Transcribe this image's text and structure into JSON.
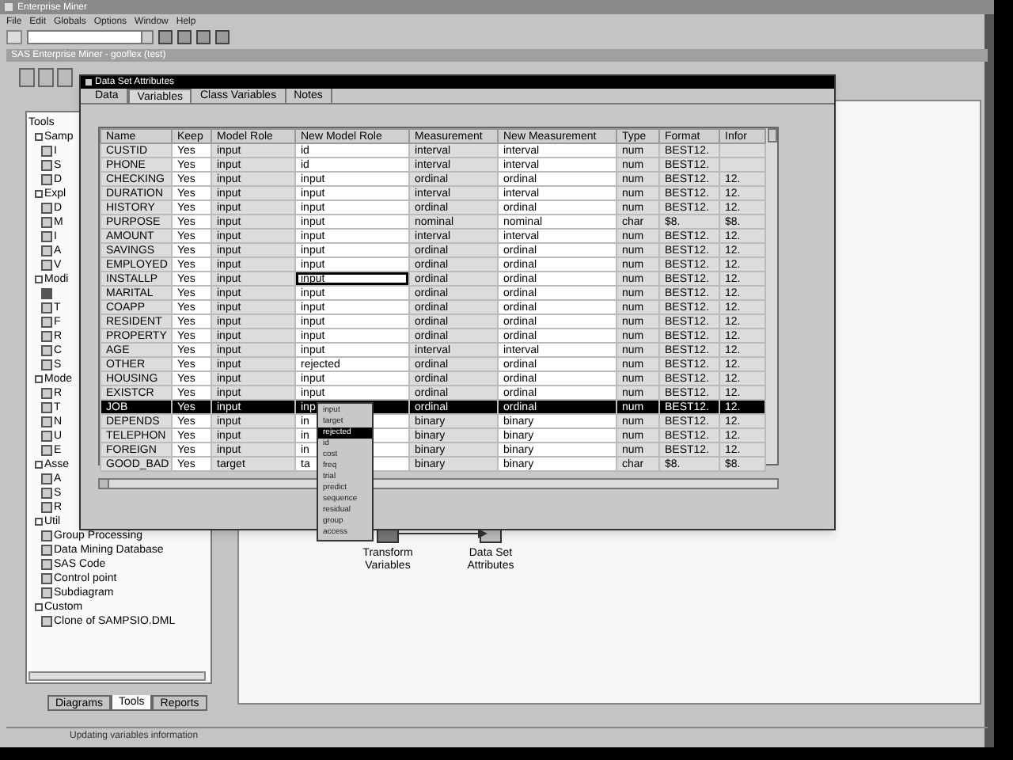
{
  "app": {
    "title": "Enterprise Miner",
    "menu": [
      "File",
      "Edit",
      "Globals",
      "Options",
      "Window",
      "Help"
    ]
  },
  "main_window": {
    "title": "SAS Enterprise Miner - gooflex (test)"
  },
  "tools_panel": {
    "tree": [
      {
        "label": "Tools",
        "expanded": true,
        "children": [
          {
            "label": "Samp",
            "expanded": true,
            "children": [
              {
                "label": "I",
                "selected": false
              },
              {
                "label": "S",
                "selected": false
              },
              {
                "label": "D",
                "selected": false
              }
            ]
          },
          {
            "label": "Expl",
            "expanded": true,
            "children": [
              {
                "label": "D",
                "selected": false
              },
              {
                "label": "M",
                "selected": false
              },
              {
                "label": "I",
                "selected": false
              },
              {
                "label": "A",
                "selected": false
              },
              {
                "label": "V",
                "selected": false
              }
            ]
          },
          {
            "label": "Modi",
            "expanded": true,
            "children": [
              {
                "selected": true
              },
              {
                "label": "T",
                "selected": false
              },
              {
                "label": "F",
                "selected": false
              },
              {
                "label": "R",
                "selected": false
              },
              {
                "label": "C",
                "selected": false
              },
              {
                "label": "S",
                "selected": false
              }
            ]
          },
          {
            "label": "Mode",
            "expanded": true,
            "children": [
              {
                "label": "R",
                "selected": false
              },
              {
                "label": "T",
                "selected": false
              },
              {
                "label": "N",
                "selected": false
              },
              {
                "label": "U",
                "selected": false
              },
              {
                "label": "E",
                "selected": false
              }
            ]
          },
          {
            "label": "Asse",
            "expanded": true,
            "children": [
              {
                "label": "A",
                "selected": false
              },
              {
                "label": "S",
                "selected": false
              },
              {
                "label": "R",
                "selected": false
              }
            ]
          },
          {
            "label": "Util",
            "expanded": true,
            "children": [
              {
                "label": "Group Processing",
                "selected": false
              },
              {
                "label": "Data Mining Database",
                "selected": false
              },
              {
                "label": "SAS Code",
                "selected": false
              },
              {
                "label": "Control point",
                "selected": false
              },
              {
                "label": "Subdiagram",
                "selected": false
              }
            ]
          },
          {
            "label": "Custom",
            "expanded": true,
            "children": [
              {
                "label": "Clone of SAMPSIO.DML",
                "selected": false
              }
            ]
          }
        ]
      }
    ],
    "tabs": [
      {
        "label": "Diagrams",
        "selected": false
      },
      {
        "label": "Tools",
        "selected": true
      },
      {
        "label": "Reports",
        "selected": false
      }
    ]
  },
  "diagram": {
    "nodes": [
      {
        "label": "Transform Variables"
      },
      {
        "label": "Data Set Attributes"
      }
    ]
  },
  "dialog": {
    "title": "Data Set Attributes",
    "tabs": [
      {
        "label": "Data",
        "selected": false
      },
      {
        "label": "Variables",
        "selected": true
      },
      {
        "label": "Class Variables",
        "selected": false
      },
      {
        "label": "Notes",
        "selected": false
      }
    ],
    "table": {
      "columns": [
        "Name",
        "Keep",
        "Model Role",
        "New Model Role",
        "Measurement",
        "New Measurement",
        "Type",
        "Format",
        "Infor"
      ],
      "rows": [
        {
          "cells": [
            "CUSTID",
            "Yes",
            "input",
            "id",
            "interval",
            "interval",
            "num",
            "BEST12."
          ],
          "selected": false,
          "editing": false
        },
        {
          "cells": [
            "PHONE",
            "Yes",
            "input",
            "id",
            "interval",
            "interval",
            "num",
            "BEST12."
          ],
          "selected": false,
          "editing": false
        },
        {
          "cells": [
            "CHECKING",
            "Yes",
            "input",
            "input",
            "ordinal",
            "ordinal",
            "num",
            "BEST12.",
            "12."
          ],
          "selected": false,
          "editing": false
        },
        {
          "cells": [
            "DURATION",
            "Yes",
            "input",
            "input",
            "interval",
            "interval",
            "num",
            "BEST12.",
            "12."
          ],
          "selected": false,
          "editing": false
        },
        {
          "cells": [
            "HISTORY",
            "Yes",
            "input",
            "input",
            "ordinal",
            "ordinal",
            "num",
            "BEST12.",
            "12."
          ],
          "selected": false,
          "editing": false
        },
        {
          "cells": [
            "PURPOSE",
            "Yes",
            "input",
            "input",
            "nominal",
            "nominal",
            "char",
            "$8.",
            "$8."
          ],
          "selected": false,
          "editing": false
        },
        {
          "cells": [
            "AMOUNT",
            "Yes",
            "input",
            "input",
            "interval",
            "interval",
            "num",
            "BEST12.",
            "12."
          ],
          "selected": false,
          "editing": false
        },
        {
          "cells": [
            "SAVINGS",
            "Yes",
            "input",
            "input",
            "ordinal",
            "ordinal",
            "num",
            "BEST12.",
            "12."
          ],
          "selected": false,
          "editing": false
        },
        {
          "cells": [
            "EMPLOYED",
            "Yes",
            "input",
            "input",
            "ordinal",
            "ordinal",
            "num",
            "BEST12.",
            "12."
          ],
          "selected": false,
          "editing": false
        },
        {
          "cells": [
            "INSTALLP",
            "Yes",
            "input",
            "input",
            "ordinal",
            "ordinal",
            "num",
            "BEST12.",
            "12."
          ],
          "selected": false,
          "editing": true
        },
        {
          "cells": [
            "MARITAL",
            "Yes",
            "input",
            "input",
            "ordinal",
            "ordinal",
            "num",
            "BEST12.",
            "12."
          ],
          "selected": false,
          "editing": false
        },
        {
          "cells": [
            "COAPP",
            "Yes",
            "input",
            "input",
            "ordinal",
            "ordinal",
            "num",
            "BEST12.",
            "12."
          ],
          "selected": false,
          "editing": false
        },
        {
          "cells": [
            "RESIDENT",
            "Yes",
            "input",
            "input",
            "ordinal",
            "ordinal",
            "num",
            "BEST12.",
            "12."
          ],
          "selected": false,
          "editing": false
        },
        {
          "cells": [
            "PROPERTY",
            "Yes",
            "input",
            "input",
            "ordinal",
            "ordinal",
            "num",
            "BEST12.",
            "12."
          ],
          "selected": false,
          "editing": false
        },
        {
          "cells": [
            "AGE",
            "Yes",
            "input",
            "input",
            "interval",
            "interval",
            "num",
            "BEST12.",
            "12."
          ],
          "selected": false,
          "editing": false
        },
        {
          "cells": [
            "OTHER",
            "Yes",
            "input",
            "rejected",
            "ordinal",
            "ordinal",
            "num",
            "BEST12.",
            "12."
          ],
          "selected": false,
          "editing": false
        },
        {
          "cells": [
            "HOUSING",
            "Yes",
            "input",
            "input",
            "ordinal",
            "ordinal",
            "num",
            "BEST12.",
            "12."
          ],
          "selected": false,
          "editing": false
        },
        {
          "cells": [
            "EXISTCR",
            "Yes",
            "input",
            "input",
            "ordinal",
            "ordinal",
            "num",
            "BEST12.",
            "12."
          ],
          "selected": false,
          "editing": false
        },
        {
          "cells": [
            "JOB",
            "Yes",
            "input",
            "inp",
            "ordinal",
            "ordinal",
            "num",
            "BEST12.",
            "12."
          ],
          "selected": true,
          "editing": false
        },
        {
          "cells": [
            "DEPENDS",
            "Yes",
            "input",
            "in",
            "binary",
            "binary",
            "num",
            "BEST12.",
            "12."
          ],
          "selected": false,
          "editing": false
        },
        {
          "cells": [
            "TELEPHON",
            "Yes",
            "input",
            "in",
            "binary",
            "binary",
            "num",
            "BEST12.",
            "12."
          ],
          "selected": false,
          "editing": false
        },
        {
          "cells": [
            "FOREIGN",
            "Yes",
            "input",
            "in",
            "binary",
            "binary",
            "num",
            "BEST12.",
            "12."
          ],
          "selected": false,
          "editing": false
        },
        {
          "cells": [
            "GOOD_BAD",
            "Yes",
            "target",
            "ta",
            "binary",
            "binary",
            "char",
            "$8.",
            "$8."
          ],
          "selected": false,
          "editing": false
        }
      ]
    },
    "popup_menu": {
      "items": [
        {
          "label": "input",
          "selected": false
        },
        {
          "label": "target",
          "selected": false
        },
        {
          "label": "rejected",
          "selected": true
        },
        {
          "label": "id",
          "selected": false
        },
        {
          "label": "cost",
          "selected": false
        },
        {
          "label": "freq",
          "selected": false
        },
        {
          "label": "trial",
          "selected": false
        },
        {
          "label": "predict",
          "selected": false
        },
        {
          "label": "sequence",
          "selected": false
        },
        {
          "label": "residual",
          "selected": false
        },
        {
          "label": "group",
          "selected": false
        },
        {
          "label": "access",
          "selected": false
        }
      ]
    }
  },
  "status_bar": "Updating variables information"
}
